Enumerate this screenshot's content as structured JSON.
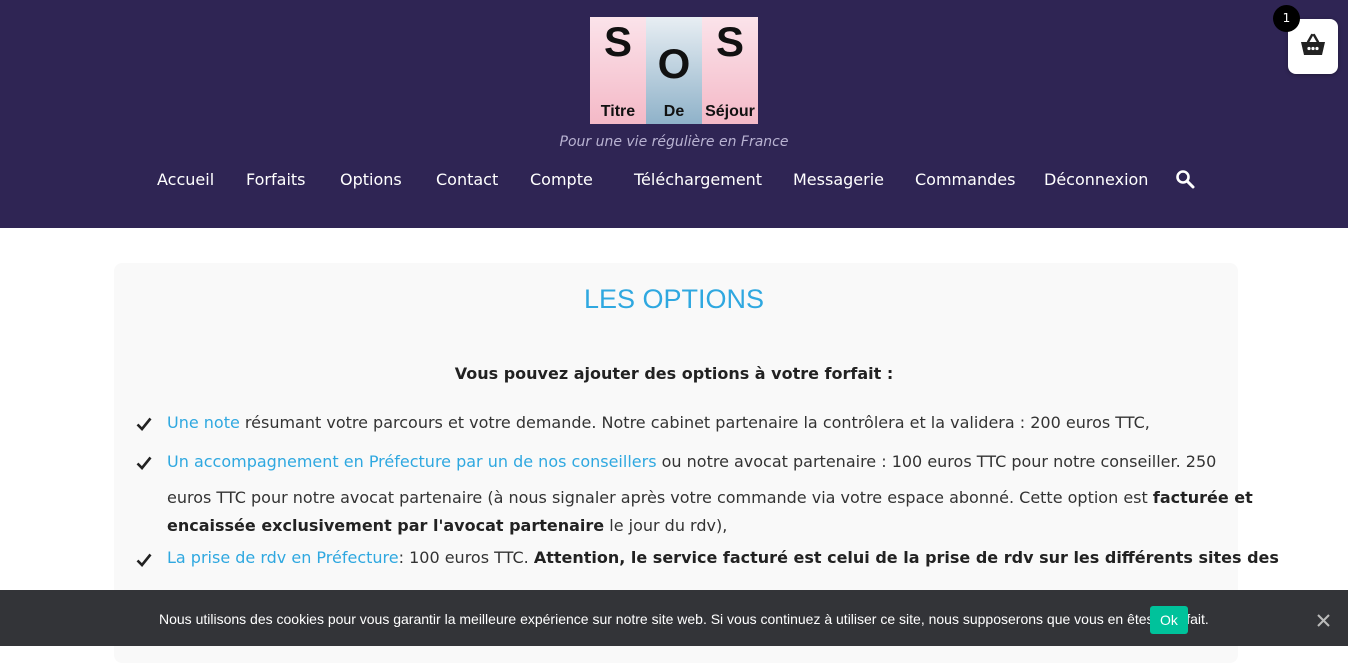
{
  "logo": {
    "letters": [
      "S",
      "O",
      "S"
    ],
    "words": [
      "Titre",
      "De",
      "Séjour"
    ]
  },
  "tagline": "Pour une vie régulière en France",
  "nav": [
    {
      "label": "Accueil",
      "name": "nav-accueil"
    },
    {
      "label": "Forfaits",
      "name": "nav-forfaits"
    },
    {
      "label": "Options",
      "name": "nav-options"
    },
    {
      "label": "Contact",
      "name": "nav-contact"
    },
    {
      "label": "Compte",
      "name": "nav-compte"
    },
    {
      "label": "Téléchargement",
      "name": "nav-telechargement"
    },
    {
      "label": "Messagerie",
      "name": "nav-messagerie"
    },
    {
      "label": "Commandes",
      "name": "nav-commandes"
    },
    {
      "label": "Déconnexion",
      "name": "nav-deconnexion"
    }
  ],
  "cart": {
    "count": "1",
    "icon": "basket-icon"
  },
  "search": {
    "icon": "search-icon"
  },
  "content": {
    "title": "LES OPTIONS",
    "intro": "Vous pouvez ajouter des options à votre forfait :",
    "items": [
      {
        "link": "Une note",
        "text": " résumant votre parcours et votre demande. Notre cabinet partenaire la contrôlera et la validera : 200 euros TTC,"
      },
      {
        "link": "Un accompagnement en Préfecture par un de nos conseillers",
        "text": " ou notre avocat partenaire : 100 euros TTC pour notre conseiller. 250",
        "line2": "euros TTC pour notre avocat partenaire (à nous signaler après votre commande via votre espace abonné. Cette option est ",
        "line2_bold": "facturée et",
        "line3_bold": "encaissée exclusivement par l'avocat partenaire",
        "line3": " le jour du rdv),"
      },
      {
        "link": "La prise de rdv en Préfecture",
        "text": ": 100 euros TTC. ",
        "bold": "Attention, le service facturé est celui de la prise de rdv sur les différents sites des"
      }
    ]
  },
  "cookie": {
    "text": "Nous utilisons des cookies pour vous garantir la meilleure expérience sur notre site web. Si vous continuez à utiliser ce site, nous supposerons que vous en êtes satisfait.",
    "ok_label": "Ok",
    "close_icon": "close-icon"
  },
  "colors": {
    "header_bg": "#2f2554",
    "accent": "#2fa8e0",
    "cookie_bg": "#333438",
    "ok_bg": "#00c29b"
  }
}
